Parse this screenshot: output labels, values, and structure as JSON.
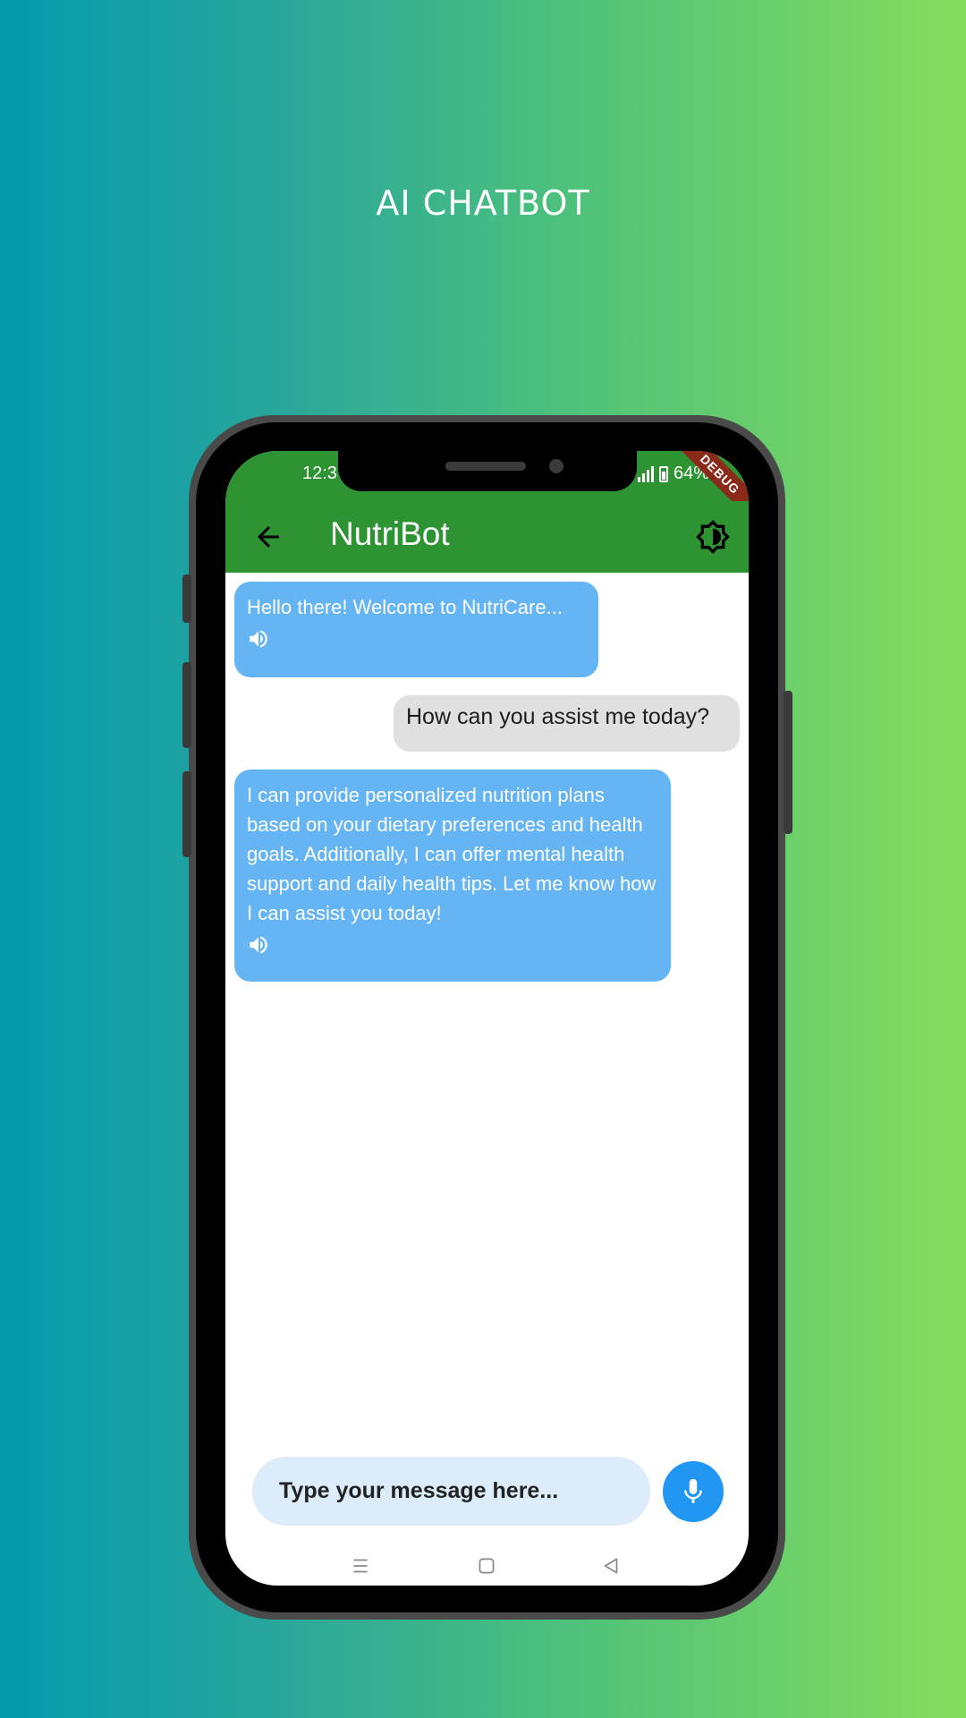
{
  "page": {
    "title": "AI CHATBOT"
  },
  "status_bar": {
    "time": "12:3",
    "battery": "64%"
  },
  "debug_banner": "DEBUG",
  "app_bar": {
    "title": "NutriBot"
  },
  "messages": [
    {
      "sender": "bot",
      "text": "Hello there! Welcome to NutriCare..."
    },
    {
      "sender": "user",
      "text": "How can you assist me today?"
    },
    {
      "sender": "bot",
      "text": "I can provide personalized nutrition plans based on your dietary preferences and health goals. Additionally, I can offer mental health support and daily health tips. Let me know how I can assist you today!"
    }
  ],
  "composer": {
    "placeholder": "Type your message here..."
  },
  "icons": {
    "back": "arrow-left-icon",
    "theme": "brightness-icon",
    "speaker": "volume-icon",
    "mic": "microphone-icon",
    "nav_menu": "menu-icon",
    "nav_home": "home-icon",
    "nav_back": "triangle-back-icon"
  },
  "colors": {
    "app_bar": "#2e9332",
    "bot_bubble": "#65b4f4",
    "user_bubble": "#e0e0e0",
    "mic_button": "#2196f3",
    "input_bg": "#dcecfb"
  }
}
